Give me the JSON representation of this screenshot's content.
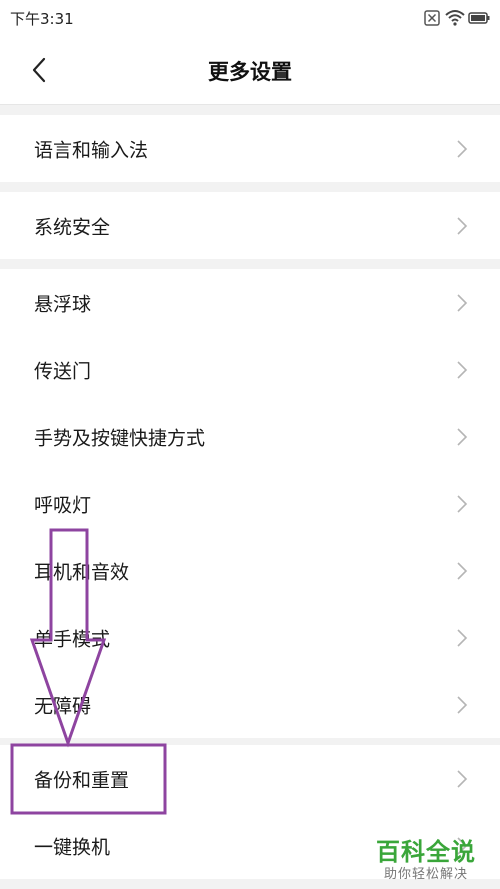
{
  "status_bar": {
    "time": "下午3:31",
    "icons": [
      "sim-x-icon",
      "wifi-icon",
      "battery-icon"
    ]
  },
  "header": {
    "title": "更多设置",
    "back_icon": "chevron-left-icon"
  },
  "groups": [
    {
      "items": [
        {
          "label": "语言和输入法"
        }
      ]
    },
    {
      "items": [
        {
          "label": "系统安全"
        }
      ]
    },
    {
      "items": [
        {
          "label": "悬浮球"
        },
        {
          "label": "传送门"
        },
        {
          "label": "手势及按键快捷方式"
        },
        {
          "label": "呼吸灯"
        },
        {
          "label": "耳机和音效"
        },
        {
          "label": "单手模式"
        },
        {
          "label": "无障碍"
        }
      ]
    },
    {
      "items": [
        {
          "label": "备份和重置"
        },
        {
          "label": "一键换机"
        }
      ]
    }
  ],
  "annotation": {
    "color": "#8e44a0",
    "shape": "down-arrow-pointing-to-highlight-box",
    "highlighted_item": "备份和重置"
  },
  "watermark": {
    "title": "百科全说",
    "subtitle": "助你轻松解决"
  },
  "colors": {
    "background": "#f2f2f2",
    "surface": "#ffffff",
    "chevron": "#b5b5b5",
    "watermark_green": "#3aa63a"
  }
}
